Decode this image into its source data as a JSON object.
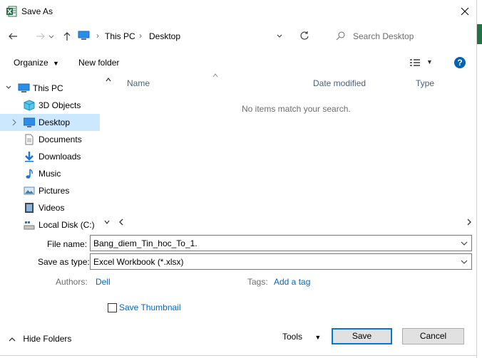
{
  "window": {
    "title": "Save As",
    "close_label": "×"
  },
  "address": {
    "segments": [
      "This PC",
      "Desktop"
    ],
    "search_placeholder": "Search Desktop"
  },
  "toolbar": {
    "organize_label": "Organize",
    "new_folder_label": "New folder"
  },
  "nav": {
    "items": [
      {
        "label": "This PC",
        "icon": "pc-icon"
      },
      {
        "label": "3D Objects",
        "icon": "cube-icon"
      },
      {
        "label": "Desktop",
        "icon": "desktop-icon",
        "selected": true
      },
      {
        "label": "Documents",
        "icon": "document-icon"
      },
      {
        "label": "Downloads",
        "icon": "download-arrow-icon"
      },
      {
        "label": "Music",
        "icon": "music-note-icon"
      },
      {
        "label": "Pictures",
        "icon": "picture-icon"
      },
      {
        "label": "Videos",
        "icon": "film-icon"
      },
      {
        "label": "Local Disk (C:)",
        "icon": "drive-icon"
      }
    ]
  },
  "list": {
    "columns": [
      "Name",
      "Date modified",
      "Type"
    ],
    "empty_message": "No items match your search."
  },
  "form": {
    "file_name_label": "File name:",
    "file_name_value": "Bang_diem_Tin_hoc_To_1.",
    "save_type_label": "Save as type:",
    "save_type_value": "Excel Workbook (*.xlsx)",
    "authors_label": "Authors:",
    "authors_value": "Dell",
    "tags_label": "Tags:",
    "tags_value": "Add a tag",
    "thumbnail_label": "Save Thumbnail"
  },
  "footer": {
    "hide_folders_label": "Hide Folders",
    "tools_label": "Tools",
    "save_label": "Save",
    "cancel_label": "Cancel"
  },
  "colors": {
    "accent": "#0078d7",
    "selection": "#cce8ff",
    "excel_green": "#217346",
    "link": "#0066cc"
  }
}
